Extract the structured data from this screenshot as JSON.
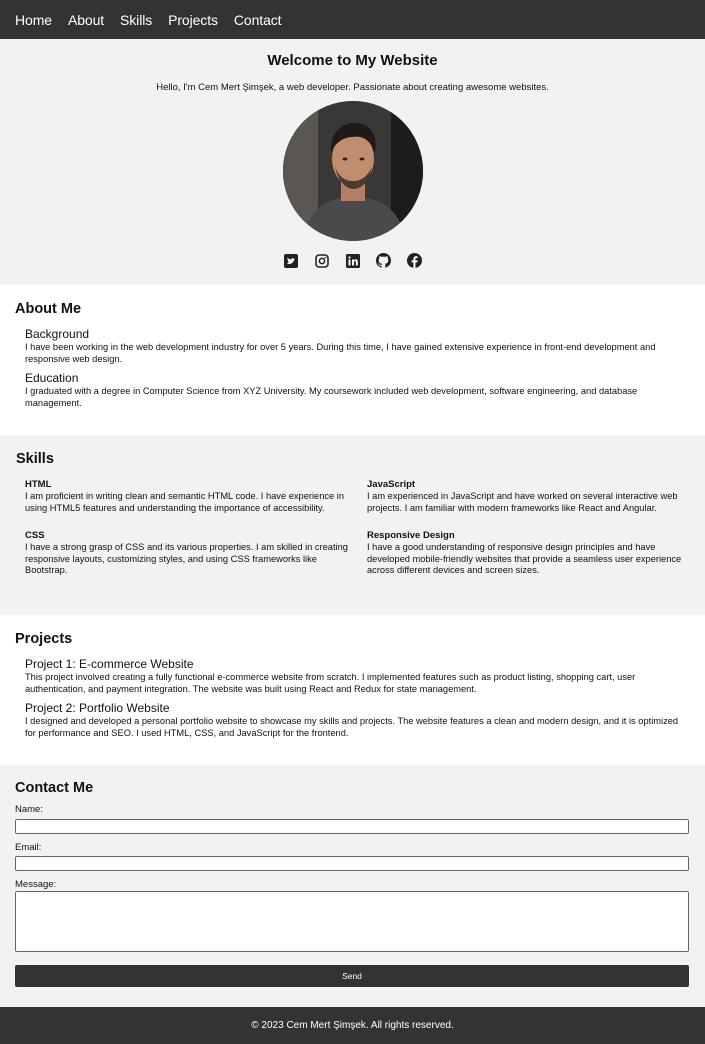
{
  "nav": {
    "items": [
      "Home",
      "About",
      "Skills",
      "Projects",
      "Contact"
    ]
  },
  "hero": {
    "title": "Welcome to My Website",
    "intro": "Hello, I'm Cem Mert Şimşek, a web developer. Passionate about creating awesome websites.",
    "socials": [
      "twitter-icon",
      "instagram-icon",
      "linkedin-icon",
      "github-icon",
      "facebook-icon"
    ]
  },
  "about": {
    "heading": "About Me",
    "background_title": "Background",
    "background_text": "I have been working in the web development industry for over 5 years. During this time, I have gained extensive experience in front-end development and responsive web design.",
    "education_title": "Education",
    "education_text": "I graduated with a degree in Computer Science from XYZ University. My coursework included web development, software engineering, and database management."
  },
  "skills": {
    "heading": "Skills",
    "items": [
      {
        "title": "HTML",
        "text": "I am proficient in writing clean and semantic HTML code. I have experience in using HTML5 features and understanding the importance of accessibility."
      },
      {
        "title": "JavaScript",
        "text": "I am experienced in JavaScript and have worked on several interactive web projects. I am familiar with modern frameworks like React and Angular."
      },
      {
        "title": "CSS",
        "text": "I have a strong grasp of CSS and its various properties. I am skilled in creating responsive layouts, customizing styles, and using CSS frameworks like Bootstrap."
      },
      {
        "title": "Responsive Design",
        "text": "I have a good understanding of responsive design principles and have developed mobile-friendly websites that provide a seamless user experience across different devices and screen sizes."
      }
    ]
  },
  "projects": {
    "heading": "Projects",
    "items": [
      {
        "title": "Project 1: E-commerce Website",
        "text": "This project involved creating a fully functional e-commerce website from scratch. I implemented features such as product listing, shopping cart, user authentication, and payment integration. The website was built using React and Redux for state management."
      },
      {
        "title": "Project 2: Portfolio Website",
        "text": "I designed and developed a personal portfolio website to showcase my skills and projects. The website features a clean and modern design, and it is optimized for performance and SEO. I used HTML, CSS, and JavaScript for the frontend."
      }
    ]
  },
  "contact": {
    "heading": "Contact Me",
    "name_label": "Name:",
    "name_value": "",
    "email_label": "Email:",
    "email_value": "",
    "message_label": "Message:",
    "message_value": "",
    "send_label": "Send"
  },
  "footer": {
    "text": "© 2023 Cem Mert Şimşek. All rights reserved."
  },
  "colors": {
    "nav_bg": "#333333",
    "section_alt_bg": "#f2f2f2",
    "button_bg": "#333333"
  }
}
